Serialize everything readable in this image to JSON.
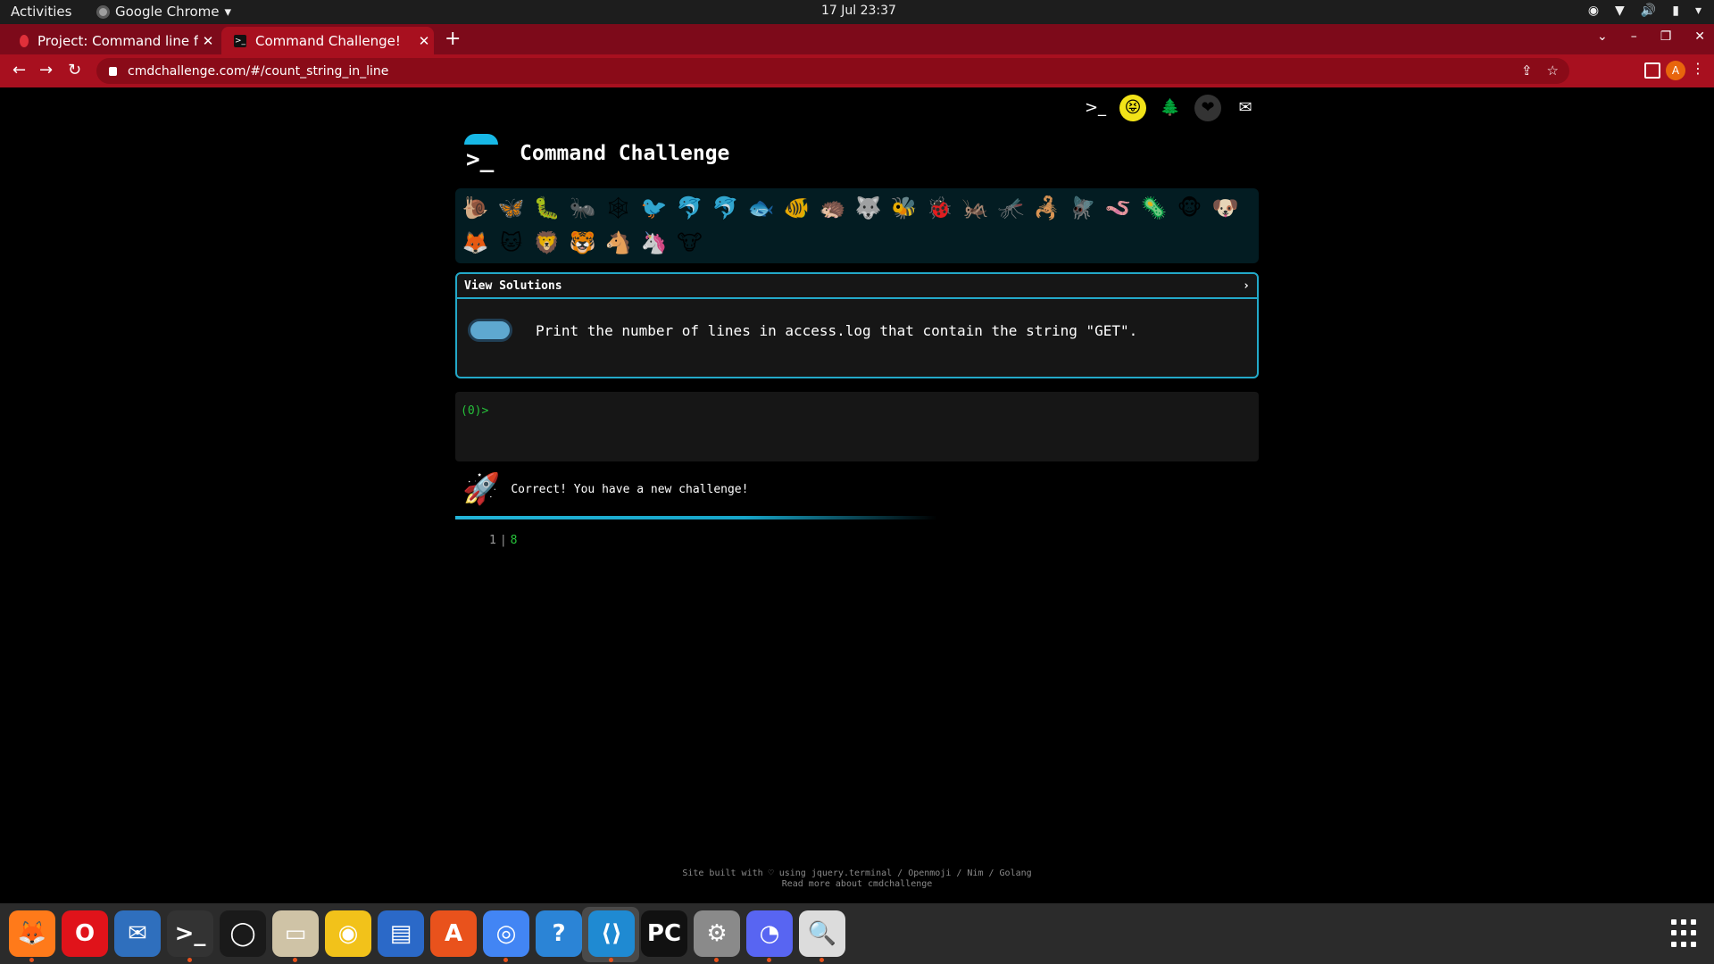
{
  "system": {
    "activities": "Activities",
    "app_name": "Google Chrome",
    "clock": "17 Jul  23:37"
  },
  "browser": {
    "tabs": [
      {
        "title": "Project: Command line fo",
        "active": false
      },
      {
        "title": "Command Challenge!",
        "active": true
      }
    ],
    "url": "cmdchallenge.com/#/count_string_in_line",
    "profile_initial": "A"
  },
  "page": {
    "title": "Command Challenge",
    "emojis": [
      "🐌",
      "🦋",
      "🐛",
      "🐜",
      "🕸",
      "🐦",
      "🐬",
      "🐬",
      "🐟",
      "🐠",
      "🦔",
      "🐺",
      "🐝",
      "🐞",
      "🦗",
      "🦟",
      "🦂",
      "🪰",
      "🪱",
      "🦠",
      "🐵",
      "🐶",
      "🦊",
      "🐱",
      "🦁",
      "🐯",
      "🐴",
      "🦄",
      "🐮"
    ],
    "view_solutions": "View Solutions",
    "challenge_text": "Print the number of lines in access.log that contain the string \"GET\".",
    "prompt": "(0)>",
    "result_message": "Correct! You have a new challenge!",
    "output_line_number": "1",
    "output_value": "8",
    "footer_line1": "Site built with ♡ using jquery.terminal / Openmoji / Nim / Golang",
    "footer_line2": "Read more about cmdchallenge"
  },
  "dock": {
    "apps": [
      "firefox-icon",
      "opera-icon",
      "thunderbird-icon",
      "terminal-icon",
      "obs-icon",
      "files-icon",
      "rhythmbox-icon",
      "writer-icon",
      "software-icon",
      "chrome-icon",
      "help-icon",
      "vscode-icon",
      "pycharm-icon",
      "settings-icon",
      "discord-icon",
      "image-viewer-icon"
    ]
  }
}
